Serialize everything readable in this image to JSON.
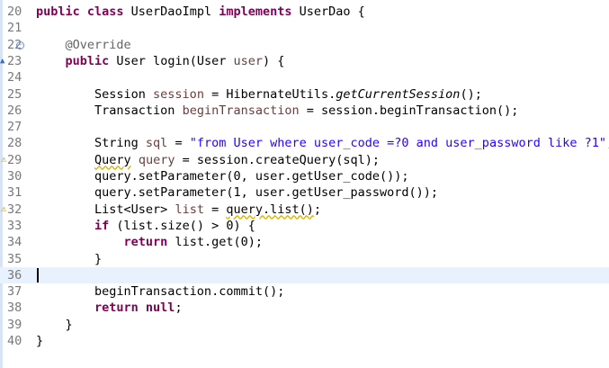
{
  "editor": {
    "lines": [
      {
        "num": "20",
        "parts": [
          {
            "t": "public class ",
            "c": "kw"
          },
          {
            "t": "UserDaoImpl ",
            "c": ""
          },
          {
            "t": "implements ",
            "c": "kw"
          },
          {
            "t": "UserDao {",
            "c": ""
          }
        ]
      },
      {
        "num": "21",
        "parts": []
      },
      {
        "num": "22",
        "parts": [
          {
            "t": "    ",
            "c": ""
          },
          {
            "t": "@Override",
            "c": "ann"
          }
        ]
      },
      {
        "num": "23",
        "parts": [
          {
            "t": "    ",
            "c": ""
          },
          {
            "t": "public ",
            "c": "kw"
          },
          {
            "t": "User login(User ",
            "c": ""
          },
          {
            "t": "user",
            "c": "param"
          },
          {
            "t": ") {",
            "c": ""
          }
        ]
      },
      {
        "num": "24",
        "parts": []
      },
      {
        "num": "25",
        "parts": [
          {
            "t": "        Session ",
            "c": ""
          },
          {
            "t": "session",
            "c": "param"
          },
          {
            "t": " = HibernateUtils.",
            "c": ""
          },
          {
            "t": "getCurrentSession",
            "c": "italic"
          },
          {
            "t": "();",
            "c": ""
          }
        ]
      },
      {
        "num": "26",
        "parts": [
          {
            "t": "        Transaction ",
            "c": ""
          },
          {
            "t": "beginTransaction",
            "c": "param"
          },
          {
            "t": " = session.beginTransaction();",
            "c": ""
          }
        ]
      },
      {
        "num": "27",
        "parts": []
      },
      {
        "num": "28",
        "parts": [
          {
            "t": "        String ",
            "c": ""
          },
          {
            "t": "sql",
            "c": "param"
          },
          {
            "t": " = ",
            "c": ""
          },
          {
            "t": "\"from User where user_code =?0 and user_password like ?1\"",
            "c": "str"
          },
          {
            "t": ";",
            "c": ""
          }
        ]
      },
      {
        "num": "29",
        "parts": [
          {
            "t": "        ",
            "c": ""
          },
          {
            "t": "Query",
            "c": "underline-warn"
          },
          {
            "t": " ",
            "c": ""
          },
          {
            "t": "query",
            "c": "param"
          },
          {
            "t": " = session.createQuery(sql);",
            "c": ""
          }
        ]
      },
      {
        "num": "30",
        "parts": [
          {
            "t": "        query.setParameter(0, user.getUser_code());",
            "c": ""
          }
        ]
      },
      {
        "num": "31",
        "parts": [
          {
            "t": "        query.setParameter(1, user.getUser_password());",
            "c": ""
          }
        ]
      },
      {
        "num": "32",
        "parts": [
          {
            "t": "        List<User> ",
            "c": ""
          },
          {
            "t": "list",
            "c": "param"
          },
          {
            "t": " = ",
            "c": ""
          },
          {
            "t": "query.list()",
            "c": "underline-warn"
          },
          {
            "t": ";",
            "c": ""
          }
        ]
      },
      {
        "num": "33",
        "parts": [
          {
            "t": "        ",
            "c": ""
          },
          {
            "t": "if ",
            "c": "kw"
          },
          {
            "t": "(list.size() > 0) {",
            "c": ""
          }
        ]
      },
      {
        "num": "34",
        "parts": [
          {
            "t": "            ",
            "c": ""
          },
          {
            "t": "return ",
            "c": "kw"
          },
          {
            "t": "list.get(0);",
            "c": ""
          }
        ]
      },
      {
        "num": "35",
        "parts": [
          {
            "t": "        }",
            "c": ""
          }
        ]
      },
      {
        "num": "36",
        "parts": []
      },
      {
        "num": "37",
        "parts": [
          {
            "t": "        beginTransaction.commit();",
            "c": ""
          }
        ]
      },
      {
        "num": "38",
        "parts": [
          {
            "t": "        ",
            "c": ""
          },
          {
            "t": "return null",
            "c": "kw"
          },
          {
            "t": ";",
            "c": ""
          }
        ]
      },
      {
        "num": "39",
        "parts": [
          {
            "t": "    }",
            "c": ""
          }
        ]
      },
      {
        "num": "40",
        "parts": [
          {
            "t": "}",
            "c": ""
          }
        ]
      }
    ],
    "current_line": "36",
    "markers": {
      "fold_line": "22",
      "override_line": "23",
      "warning_lines": [
        "29",
        "32"
      ]
    },
    "colors": {
      "keyword": "#7f0055",
      "string": "#2a00ff",
      "annotation": "#646464",
      "variable": "#6a3e3e",
      "current_line_bg": "#e8f2fe",
      "line_number": "#787878"
    },
    "icons": {
      "fold": "fold-collapse-icon",
      "override": "override-marker-icon",
      "warning": "warning-icon"
    }
  }
}
